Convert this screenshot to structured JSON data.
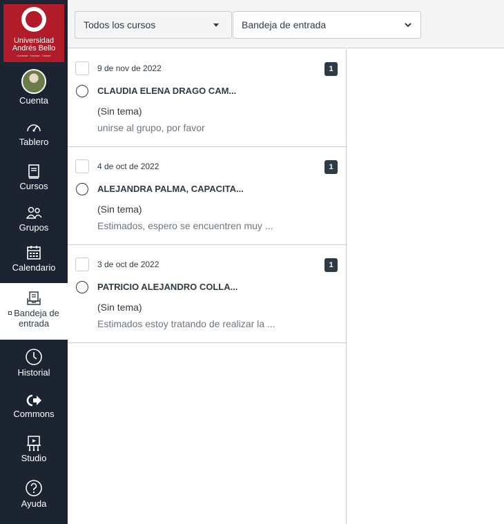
{
  "logo": {
    "line1": "Universidad",
    "line2": "Andrés Bello",
    "tagline": "Conectar · Innovar · Liderar"
  },
  "nav": {
    "items": [
      {
        "label": "Cuenta",
        "icon": "avatar-icon"
      },
      {
        "label": "Tablero",
        "icon": "dashboard-icon"
      },
      {
        "label": "Cursos",
        "icon": "courses-icon"
      },
      {
        "label": "Grupos",
        "icon": "groups-icon"
      },
      {
        "label": "Calendario",
        "icon": "calendar-icon"
      },
      {
        "label_line1": "Bandeja de",
        "label_line2": "entrada",
        "icon": "inbox-icon",
        "active": true
      },
      {
        "label": "Historial",
        "icon": "history-icon"
      },
      {
        "label": "Commons",
        "icon": "commons-icon"
      },
      {
        "label": "Studio",
        "icon": "studio-icon"
      },
      {
        "label": "Ayuda",
        "icon": "help-icon"
      }
    ]
  },
  "header": {
    "course_filter": "Todos los cursos",
    "mailbox_filter": "Bandeja de entrada"
  },
  "messages": [
    {
      "date": "9 de nov de 2022",
      "count": "1",
      "sender": "CLAUDIA ELENA DRAGO CAM...",
      "subject": "(Sin tema)",
      "preview": "unirse al grupo, por favor"
    },
    {
      "date": "4 de oct de 2022",
      "count": "1",
      "sender": "ALEJANDRA PALMA, CAPACITA...",
      "subject": "(Sin tema)",
      "preview": "Estimados, espero se encuentren muy ..."
    },
    {
      "date": "3 de oct de 2022",
      "count": "1",
      "sender": "PATRICIO ALEJANDRO COLLA...",
      "subject": "(Sin tema)",
      "preview": "Estimados estoy tratando de realizar la ..."
    }
  ],
  "colors": {
    "nav_bg": "#1b2430",
    "brand_red": "#b01c27",
    "text": "#2d3b45",
    "muted": "#6b7780",
    "border": "#c7cdd1"
  }
}
